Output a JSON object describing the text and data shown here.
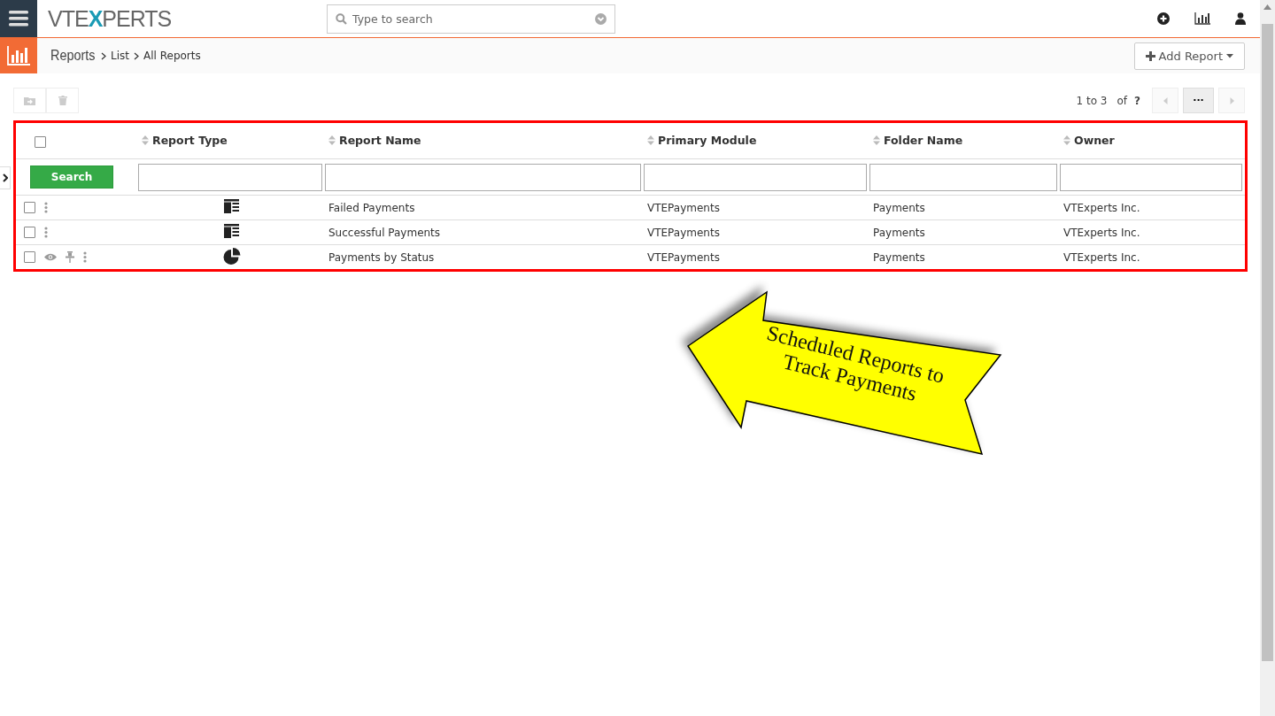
{
  "topbar": {
    "logo": [
      "VTE",
      "X",
      "PERTS"
    ],
    "search": {
      "placeholder": "Type to search"
    }
  },
  "breadcrumb": {
    "module": "Reports",
    "items": [
      "List",
      "All Reports"
    ]
  },
  "add_button": {
    "label": "Add Report"
  },
  "pagination": {
    "range": "1 to 3",
    "of": "of",
    "total": "?",
    "more": "···"
  },
  "table": {
    "columns": [
      "Report Type",
      "Report Name",
      "Primary Module",
      "Folder Name",
      "Owner"
    ],
    "search_button": "Search",
    "select_all": false,
    "rows": [
      {
        "checked": false,
        "hover_actions": false,
        "kind": "detail",
        "name": "Failed Payments",
        "module": "VTEPayments",
        "folder": "Payments",
        "owner": "VTExperts Inc."
      },
      {
        "checked": false,
        "hover_actions": false,
        "kind": "detail",
        "name": "Successful Payments",
        "module": "VTEPayments",
        "folder": "Payments",
        "owner": "VTExperts Inc."
      },
      {
        "checked": false,
        "hover_actions": true,
        "kind": "chart",
        "name": "Payments by Status",
        "module": "VTEPayments",
        "folder": "Payments",
        "owner": "VTExperts Inc."
      }
    ]
  },
  "callout": {
    "lines": [
      "Scheduled Reports to",
      "Track Payments"
    ]
  }
}
